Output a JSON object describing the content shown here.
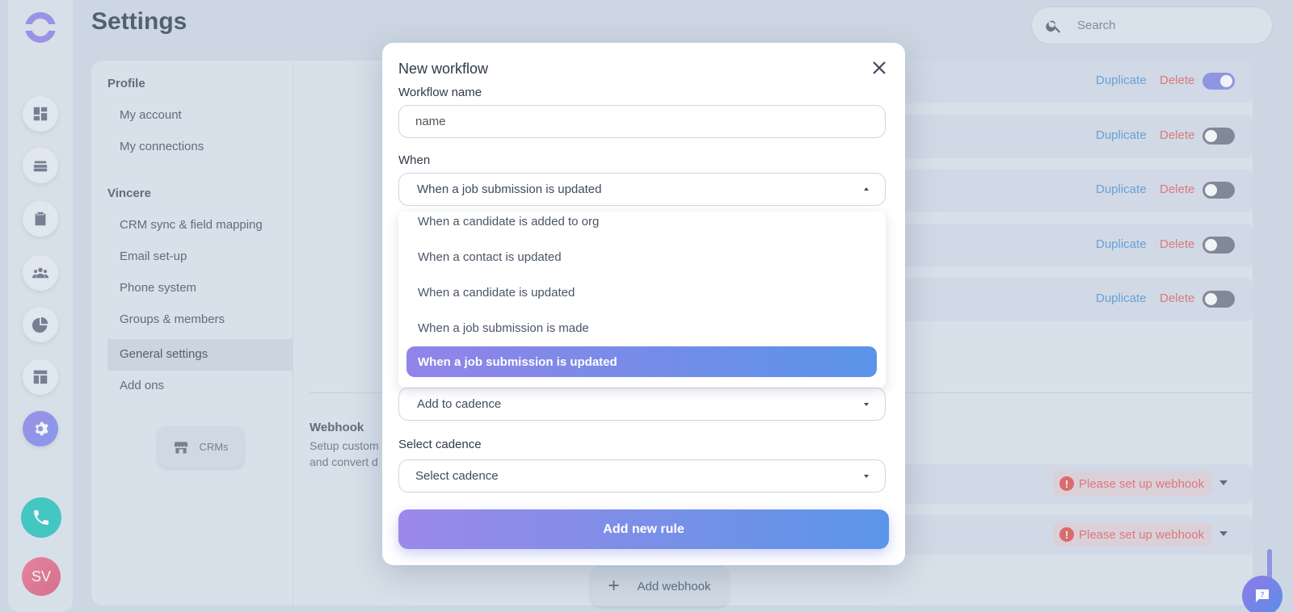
{
  "rail": {
    "avatar_initials": "SV"
  },
  "header": {
    "title": "Settings",
    "search_placeholder": "Search"
  },
  "settings_nav": {
    "sections": [
      {
        "title": "Profile",
        "items": [
          "My account",
          "My connections"
        ]
      },
      {
        "title": "Vincere",
        "items": [
          "CRM sync & field mapping",
          "Email set-up",
          "Phone system",
          "Groups & members",
          "General settings",
          "Add ons"
        ]
      }
    ],
    "active_item": "General settings",
    "crm_button": "CRMs"
  },
  "workflows": {
    "duplicate_label": "Duplicate",
    "delete_label": "Delete",
    "toggles": [
      true,
      false,
      false,
      false,
      false
    ]
  },
  "webhook": {
    "title": "Webhook",
    "description_line1": "Setup custom",
    "description_line2": "and convert d",
    "status_text": "Please set up webhook",
    "add_label": "Add webhook"
  },
  "modal": {
    "title": "New workflow",
    "workflow_name_label": "Workflow name",
    "workflow_name_placeholder": "name",
    "when_label": "When",
    "when_selected": "When a job submission is updated",
    "when_options": [
      "When a candidate is added to org",
      "When a contact is updated",
      "When a candidate is updated",
      "When a job submission is made",
      "When a job submission is updated"
    ],
    "action_selected": "Add to cadence",
    "select_cadence_label": "Select cadence",
    "select_cadence_placeholder": "Select cadence",
    "submit_label": "Add new rule"
  },
  "colors": {
    "accent": "#7b82e4",
    "danger": "#e15b5b",
    "link": "#4a8fd4",
    "phone": "#18c2b8"
  }
}
